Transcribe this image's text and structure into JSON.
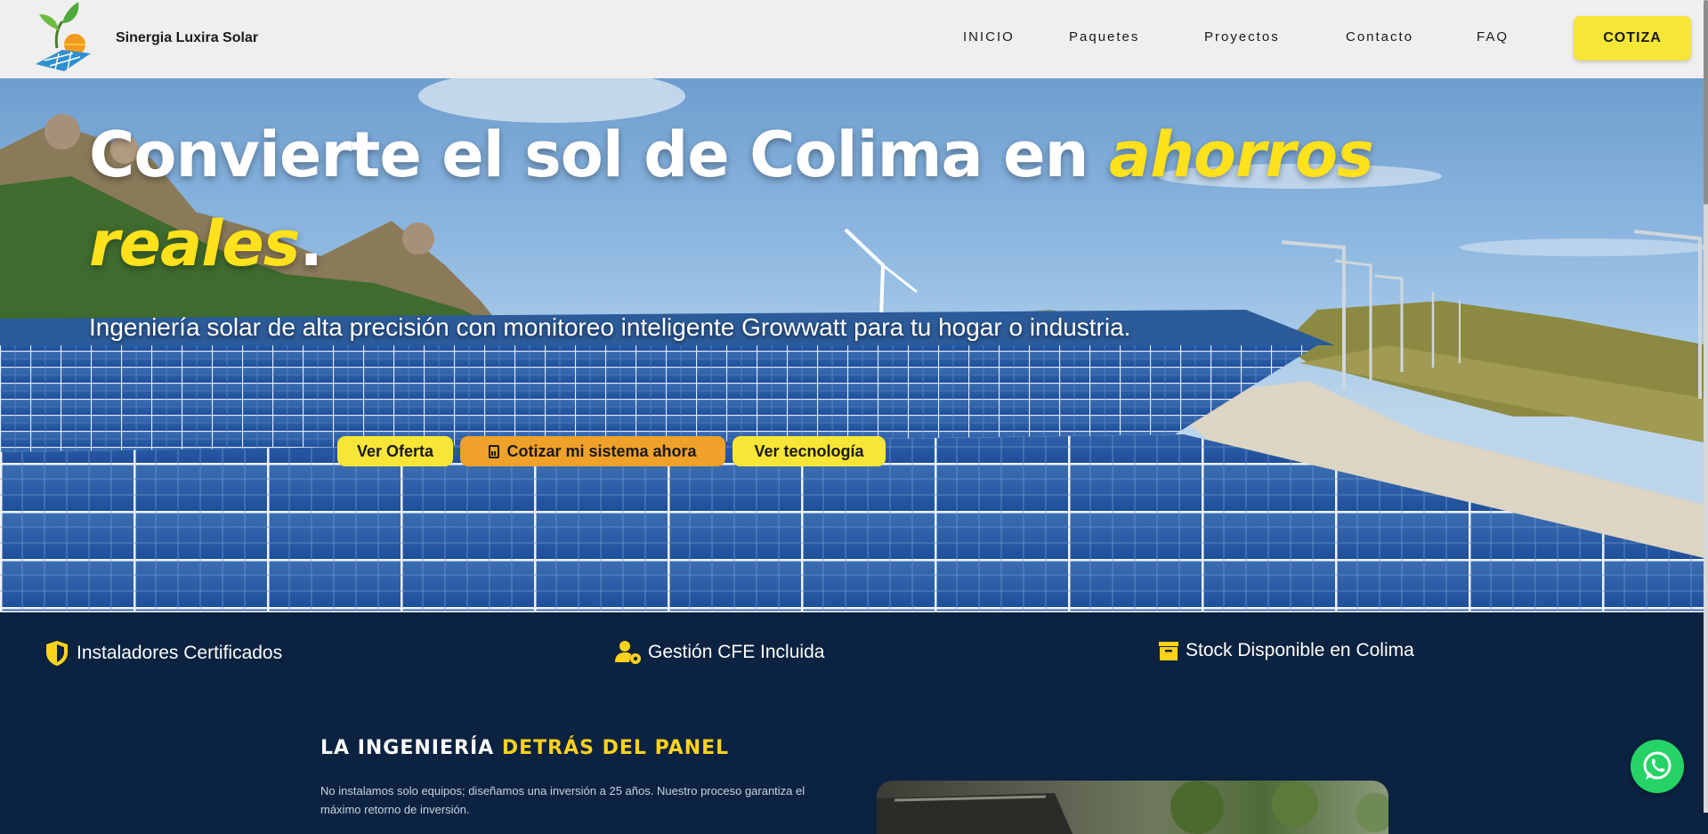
{
  "header": {
    "brand": "Sinergia Luxira Solar",
    "nav": [
      "INICIO",
      "Paquetes",
      "Proyectos",
      "Contacto",
      "FAQ"
    ],
    "cta": "COTIZA"
  },
  "hero": {
    "title_main": "Convierte el sol de Colima en ",
    "title_hl": "ahorros reales",
    "title_end": ".",
    "subtitle": "Ingeniería solar de alta precisión con monitoreo inteligente Growwatt para tu hogar o industria.",
    "buttons": {
      "offer": "Ver Oferta",
      "quote": "Cotizar mi sistema ahora",
      "tech": "Ver tecnología"
    }
  },
  "badges": [
    {
      "label": "Instaladores Certificados",
      "icon": "shield-icon"
    },
    {
      "label": "Gestión CFE Incluida",
      "icon": "user-gear-icon"
    },
    {
      "label": "Stock Disponible en Colima",
      "icon": "box-icon"
    }
  ],
  "section": {
    "title_main": "LA INGENIERÍA ",
    "title_hl": "DETRÁS DEL PANEL",
    "text": "No instalamos solo equipos; diseñamos una inversión a 25 años. Nuestro proceso garantiza el máximo retorno de inversión."
  },
  "colors": {
    "accent_yellow": "#f7e637",
    "accent_orange": "#f0a12a",
    "navy": "#0b2240",
    "whatsapp": "#25d366"
  }
}
